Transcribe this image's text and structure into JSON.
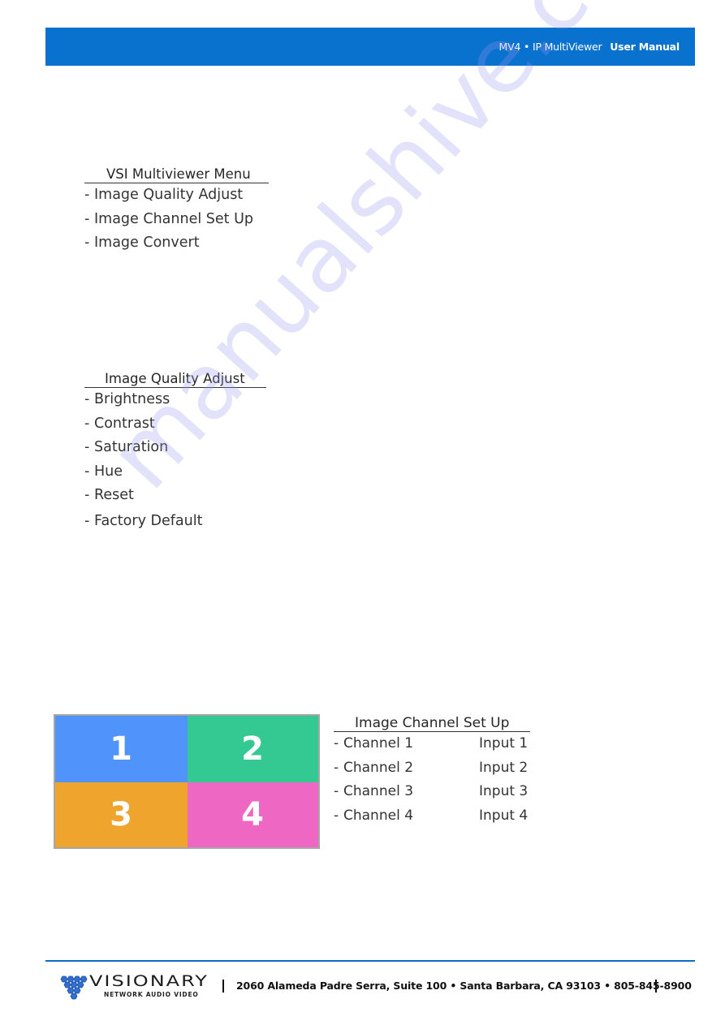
{
  "header": {
    "product": "MV4",
    "separator": "•",
    "subtitle": "IP MultiViewer",
    "doc_type": "User Manual",
    "color": "#0971ce"
  },
  "main_menu": {
    "title": "VSI Multiviewer Menu",
    "items": [
      "Image Quality Adjust",
      "Image Channel Set Up",
      "Image Convert"
    ]
  },
  "image_quality_menu": {
    "title": "Image Quality Adjust",
    "items": [
      "Brightness",
      "Contrast",
      "Saturation",
      "Hue",
      "Reset",
      "Factory Default"
    ]
  },
  "channel_grid": {
    "cells": [
      {
        "label": "1",
        "color": "#5093fb"
      },
      {
        "label": "2",
        "color": "#34c993"
      },
      {
        "label": "3",
        "color": "#efa42e"
      },
      {
        "label": "4",
        "color": "#ed67c3"
      }
    ]
  },
  "channel_menu": {
    "title": "Image Channel Set Up",
    "rows": [
      {
        "channel": "Channel 1",
        "input": "Input 1"
      },
      {
        "channel": "Channel 2",
        "input": "Input 2"
      },
      {
        "channel": "Channel 3",
        "input": "Input 3"
      },
      {
        "channel": "Channel 4",
        "input": "Input 4"
      }
    ]
  },
  "list_marker": "-",
  "watermark": "manualshive.com",
  "footer": {
    "logo_word": "VISIONARY",
    "logo_sub": "NETWORK AUDIO VIDEO",
    "address": "2060 Alameda Padre Serra, Suite 100 • Santa Barbara, CA 93103 • 805-845-8900",
    "line_color": "#0b6ec2"
  }
}
